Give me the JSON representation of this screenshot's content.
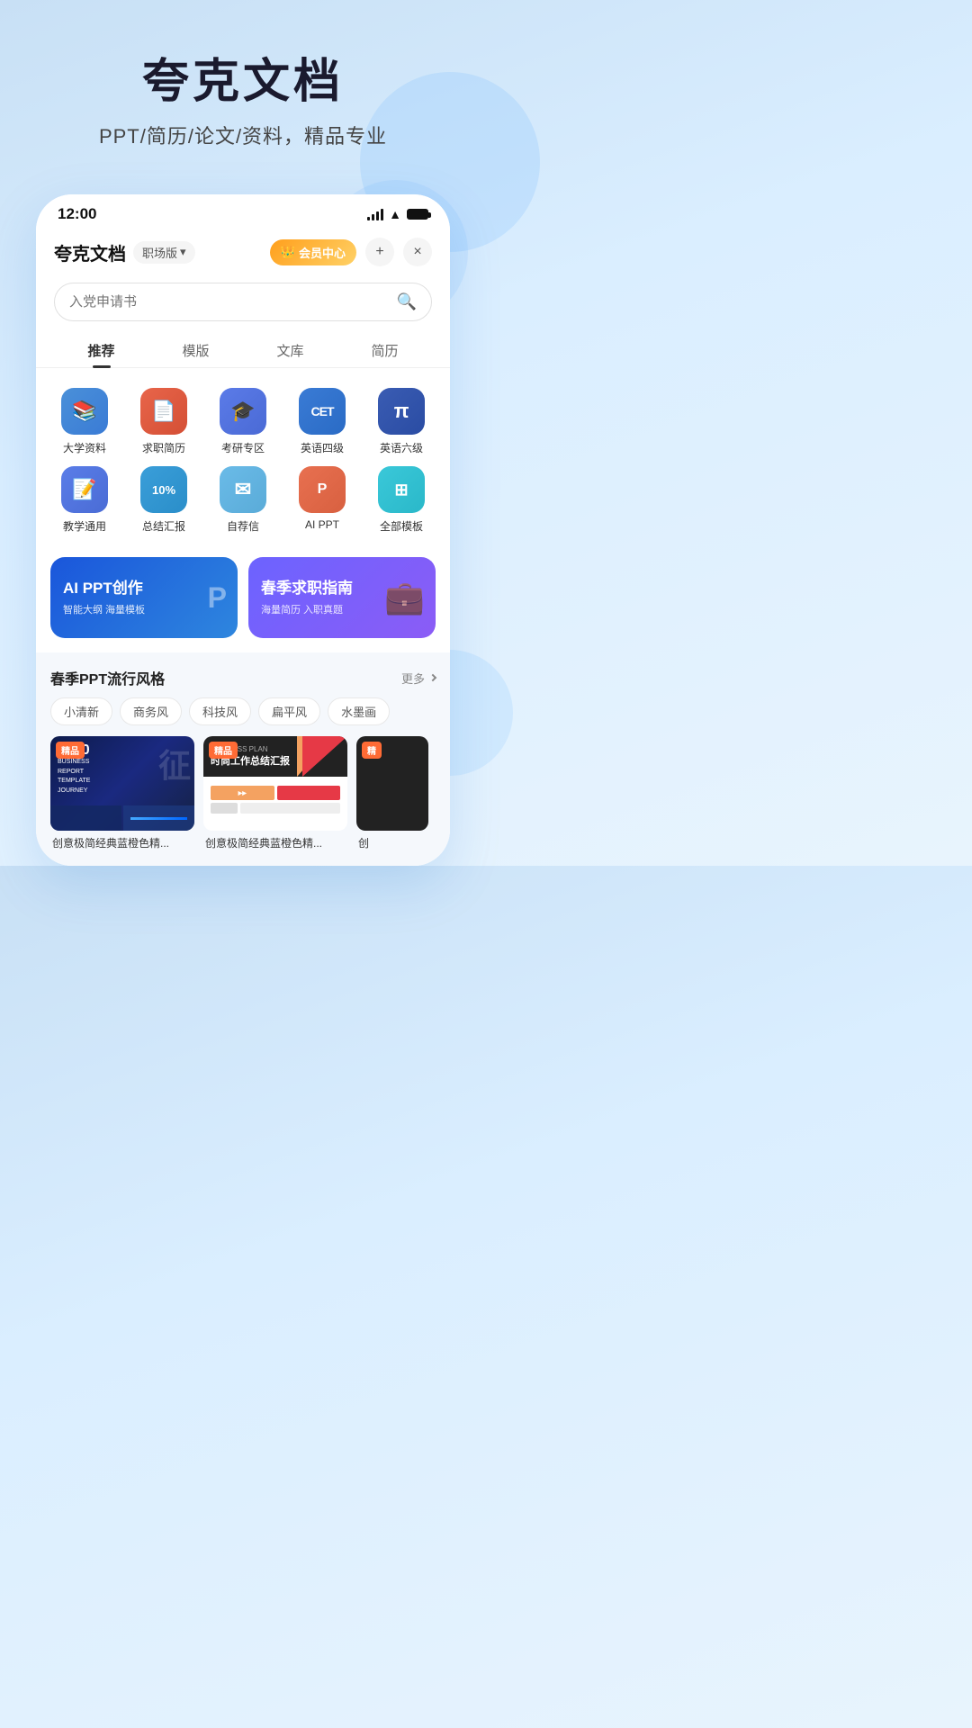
{
  "hero": {
    "title": "夸克文档",
    "subtitle": "PPT/简历/论文/资料，精品专业"
  },
  "statusBar": {
    "time": "12:00",
    "signal": "signal",
    "wifi": "wifi",
    "battery": "battery"
  },
  "appHeader": {
    "logo": "夸克文档",
    "version": "职场版",
    "vipLabel": "会员中心",
    "addIcon": "+",
    "closeIcon": "×"
  },
  "searchBar": {
    "placeholder": "入党申请书"
  },
  "navTabs": [
    {
      "label": "推荐",
      "active": true
    },
    {
      "label": "模版",
      "active": false
    },
    {
      "label": "文库",
      "active": false
    },
    {
      "label": "简历",
      "active": false
    }
  ],
  "iconGrid": [
    {
      "label": "大学资料",
      "color": "#4a90d9",
      "icon": "📚"
    },
    {
      "label": "求职简历",
      "color": "#e8654a",
      "icon": "📄"
    },
    {
      "label": "考研专区",
      "color": "#5b7be8",
      "icon": "🎓"
    },
    {
      "label": "英语四级",
      "color": "#3a7bd5",
      "icon": "CET"
    },
    {
      "label": "英语六级",
      "color": "#3a5cb3",
      "icon": "π"
    },
    {
      "label": "教学通用",
      "color": "#5a7de8",
      "icon": "📝"
    },
    {
      "label": "总结汇报",
      "color": "#3a9ed9",
      "icon": "10%"
    },
    {
      "label": "自荐信",
      "color": "#6abbe8",
      "icon": "✉"
    },
    {
      "label": "AI PPT",
      "color": "#e87050",
      "icon": "P"
    },
    {
      "label": "全部模板",
      "color": "#3ac8d9",
      "icon": "⊞"
    }
  ],
  "banners": [
    {
      "main": "AI PPT创作",
      "sub": "智能大纲 海量模板",
      "type": "blue",
      "icon": "P"
    },
    {
      "main": "春季求职指南",
      "sub": "海量简历 入职真题",
      "type": "purple",
      "icon": "💼"
    }
  ],
  "section": {
    "title": "春季PPT流行风格",
    "more": "更多"
  },
  "filterTags": [
    "小清新",
    "商务风",
    "科技风",
    "扁平风",
    "水墨画"
  ],
  "cards": [
    {
      "badge": "精品",
      "label": "创意极简经典蓝橙色精...",
      "type": "2030"
    },
    {
      "badge": "精品",
      "label": "创意极简经典蓝橙色精...",
      "type": "bizplan"
    },
    {
      "badge": "精",
      "label": "创",
      "type": "dark"
    }
  ]
}
